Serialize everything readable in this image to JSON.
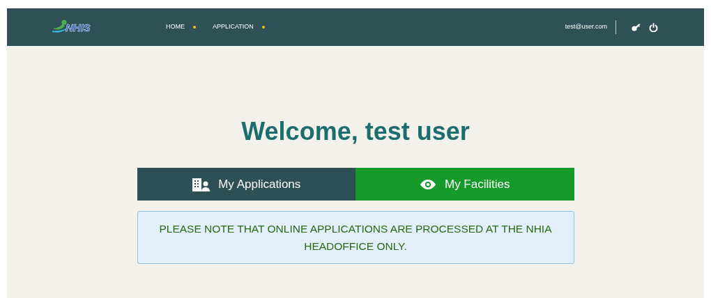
{
  "header": {
    "logo": "NHIS",
    "nav": [
      {
        "label": "HOME"
      },
      {
        "label": "APPLICATION"
      }
    ],
    "user_email": "test@user.com"
  },
  "welcome": "Welcome, test user",
  "cards": [
    {
      "label": "My Applications",
      "kind": "applications",
      "color": "#2e4f55"
    },
    {
      "label": "My Facilities",
      "kind": "facilities",
      "color": "#169a2a"
    }
  ],
  "notice": "PLEASE NOTE THAT ONLINE APPLICATIONS ARE PROCESSED AT THE NHIA HEADOFFICE ONLY."
}
